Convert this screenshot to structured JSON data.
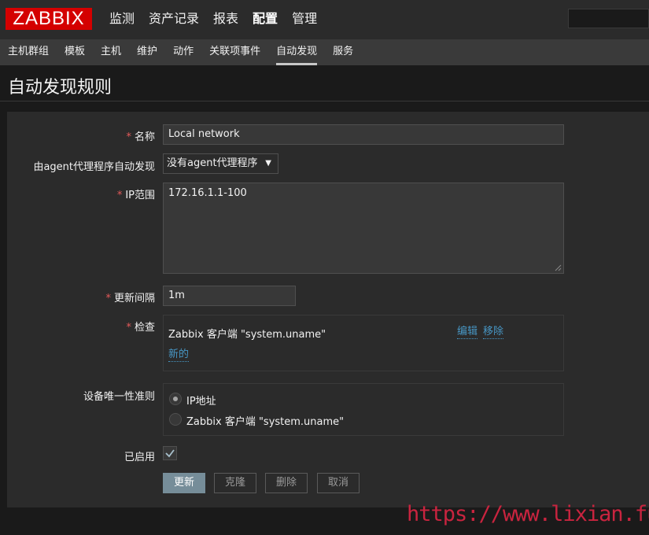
{
  "header": {
    "logo": "ZABBIX",
    "menu": [
      "监测",
      "资产记录",
      "报表",
      "配置",
      "管理"
    ],
    "active_menu": "配置",
    "search_placeholder": ""
  },
  "submenu": {
    "items": [
      "主机群组",
      "模板",
      "主机",
      "维护",
      "动作",
      "关联项事件",
      "自动发现",
      "服务"
    ],
    "active": "自动发现"
  },
  "page": {
    "title": "自动发现规则"
  },
  "form": {
    "name_label": "名称",
    "name_value": "Local network",
    "proxy_label": "由agent代理程序自动发现",
    "proxy_value": "没有agent代理程序",
    "ip_range_label": "IP范围",
    "ip_range_value": "172.16.1.1-100",
    "interval_label": "更新间隔",
    "interval_value": "1m",
    "checks_label": "检查",
    "checks": [
      {
        "name": "Zabbix 客户端 \"system.uname\"",
        "edit": "编辑",
        "remove": "移除"
      }
    ],
    "new_check": "新的",
    "uniqueness_label": "设备唯一性准则",
    "uniqueness_options": [
      "IP地址",
      "Zabbix 客户端 \"system.uname\""
    ],
    "uniqueness_selected": "IP地址",
    "enabled_label": "已启用",
    "enabled": true
  },
  "buttons": {
    "update": "更新",
    "clone": "克隆",
    "delete": "删除",
    "cancel": "取消"
  },
  "watermark": "https://www.lixian.fun",
  "colors": {
    "brand": "#d40000",
    "required": "#e45959",
    "link": "#4796c4",
    "primary_button": "#768d99"
  }
}
